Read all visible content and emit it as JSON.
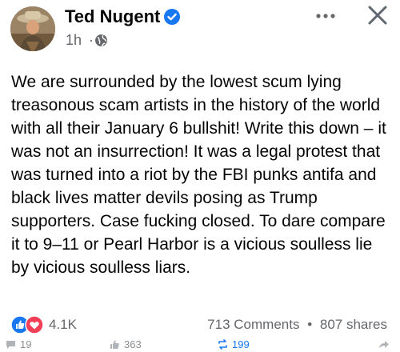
{
  "author": {
    "name": "Ted Nugent",
    "time": "1h",
    "separator": "·"
  },
  "post": {
    "text": "We are surrounded by the lowest scum lying treasonous scam artists in the history of the world with all their January 6 bullshit! Write this down – it was not an insurrection! It was a legal protest that was turned into a riot by the FBI punks antifa and black lives matter devils posing as Trump supporters. Case fucking closed. To dare compare it to 9–11 or Pearl Harbor is a vicious soulless lie by vicious soulless liars."
  },
  "stats": {
    "reactions": "4.1K",
    "comments": "713 Comments",
    "dot": "•",
    "shares": "807 shares"
  },
  "bottom_bar": {
    "comments_count": "19",
    "likes_count": "363",
    "shares_count": "199"
  },
  "colors": {
    "verified": "#1877f2",
    "like": "#1877f2",
    "love": "#f33e58",
    "secondary_text": "#65676b"
  },
  "icons": {
    "verified": "verified-badge-icon",
    "privacy": "globe-icon",
    "more": "more-dots-icon",
    "close": "close-icon",
    "like": "like-reaction-icon",
    "love": "love-reaction-icon"
  }
}
